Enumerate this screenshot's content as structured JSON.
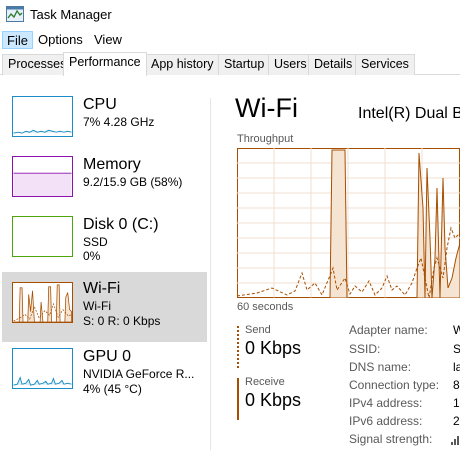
{
  "window": {
    "title": "Task Manager",
    "icon": "task-manager-icon"
  },
  "menu": {
    "file": "File",
    "options": "Options",
    "view": "View"
  },
  "tabs": [
    "Processes",
    "Performance",
    "App history",
    "Startup",
    "Users",
    "Details",
    "Services"
  ],
  "resources": [
    {
      "name": "CPU",
      "sub1": "7%  4.28 GHz",
      "sub2": "",
      "color": "#1c8dc6"
    },
    {
      "name": "Memory",
      "sub1": "9.2/15.9 GB (58%)",
      "sub2": "",
      "color": "#8b12ae"
    },
    {
      "name": "Disk 0 (C:)",
      "sub1": "SSD",
      "sub2": "0%",
      "color": "#4da60c"
    },
    {
      "name": "Wi-Fi",
      "sub1": "Wi-Fi",
      "sub2": "S: 0  R: 0 Kbps",
      "color": "#a74f01"
    },
    {
      "name": "GPU 0",
      "sub1": "NVIDIA GeForce R...",
      "sub2": "4%  (45 °C)",
      "color": "#1c8dc6"
    }
  ],
  "detail": {
    "title": "Wi-Fi",
    "adapter": "Intel(R) Dual Ba",
    "graph_label": "Throughput",
    "time_label": "60 seconds",
    "send_label": "Send",
    "send_value": "0 Kbps",
    "receive_label": "Receive",
    "receive_value": "0 Kbps",
    "properties": [
      {
        "label": "Adapter name:",
        "value": "W"
      },
      {
        "label": "SSID:",
        "value": "S"
      },
      {
        "label": "DNS name:",
        "value": "la"
      },
      {
        "label": "Connection type:",
        "value": "8"
      },
      {
        "label": "IPv4 address:",
        "value": "1"
      },
      {
        "label": "IPv6 address:",
        "value": "2"
      },
      {
        "label": "Signal strength:",
        "value": ""
      }
    ]
  },
  "colors": {
    "accent": "#a74f01",
    "selected_bg": "#d9d9d9",
    "menu_active": "#cce8ff"
  }
}
